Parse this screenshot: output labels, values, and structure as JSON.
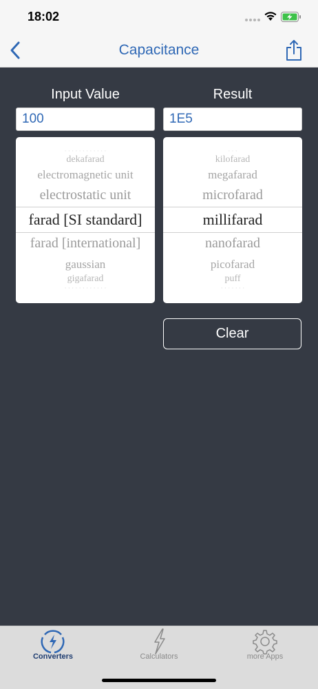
{
  "status": {
    "time": "18:02"
  },
  "nav": {
    "title": "Capacitance",
    "back_icon": "chevron-left-icon",
    "share_icon": "share-icon"
  },
  "input": {
    "label": "Input Value",
    "value": "100",
    "picker": {
      "above": [
        "dekafarad",
        "electromagnetic unit",
        "electrostatic unit"
      ],
      "selected": "farad [SI standard]",
      "below": [
        "farad [international]",
        "gaussian",
        "gigafarad"
      ]
    }
  },
  "result": {
    "label": "Result",
    "value": "1E5",
    "picker": {
      "above": [
        "kilofarad",
        "megafarad",
        "microfarad"
      ],
      "selected": "millifarad",
      "below": [
        "nanofarad",
        "picofarad",
        "puff"
      ]
    }
  },
  "clear_label": "Clear",
  "tabs": [
    {
      "label": "Converters",
      "icon": "converters-icon",
      "active": true
    },
    {
      "label": "Calculators",
      "icon": "lightning-icon",
      "active": false
    },
    {
      "label": "more Apps",
      "icon": "gear-icon",
      "active": false
    }
  ],
  "colors": {
    "accent": "#2f68b5",
    "background": "#353a44",
    "tab_active": "#1e3c70"
  }
}
